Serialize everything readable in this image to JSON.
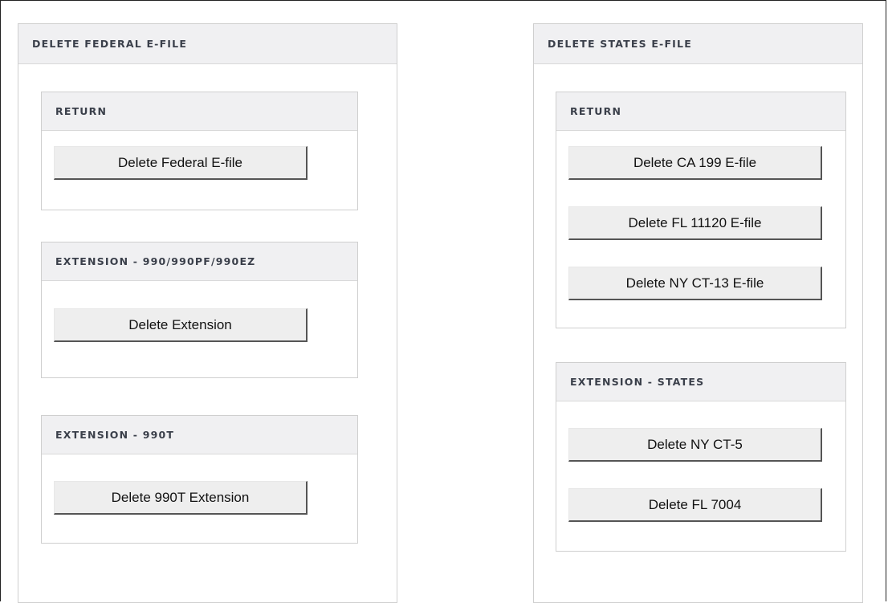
{
  "federal": {
    "title": "DELETE FEDERAL E-FILE",
    "sections": [
      {
        "header": "RETURN",
        "buttons": [
          "Delete Federal E-file"
        ]
      },
      {
        "header": "EXTENSION - 990/990PF/990EZ",
        "buttons": [
          "Delete Extension"
        ]
      },
      {
        "header": "EXTENSION - 990T",
        "buttons": [
          "Delete 990T Extension"
        ]
      }
    ]
  },
  "states": {
    "title": "DELETE STATES E-FILE",
    "sections": [
      {
        "header": "RETURN",
        "buttons": [
          "Delete CA 199 E-file",
          "Delete FL 11120 E-file",
          "Delete NY CT-13 E-file"
        ]
      },
      {
        "header": "EXTENSION - STATES",
        "buttons": [
          "Delete NY CT-5",
          "Delete FL 7004"
        ]
      }
    ]
  }
}
